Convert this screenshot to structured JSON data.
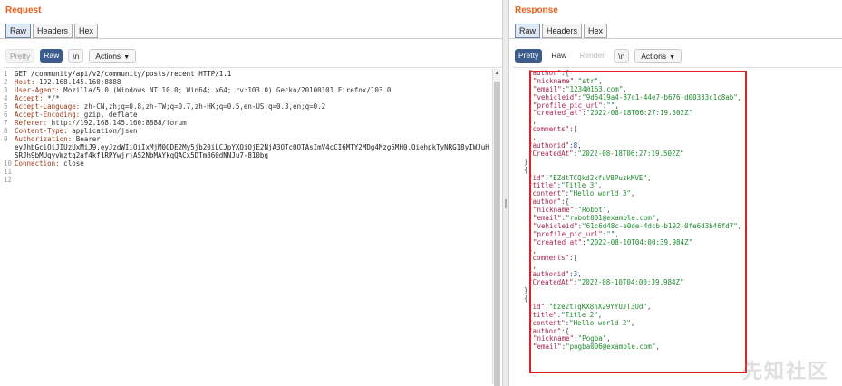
{
  "request": {
    "title": "Request",
    "tabs": [
      {
        "label": "Raw",
        "active": true
      },
      {
        "label": "Headers",
        "active": false
      },
      {
        "label": "Hex",
        "active": false
      }
    ],
    "toolbar": {
      "pretty": "Pretty",
      "raw": "Raw",
      "newline": "\\n",
      "actions": "Actions"
    },
    "line_numbers": [
      "1",
      "2",
      "3",
      "4",
      "5",
      "6",
      "7",
      "8",
      "9",
      "",
      "",
      "10",
      "11",
      "12"
    ],
    "lines": [
      {
        "name": "",
        "value": "GET /community/api/v2/community/posts/recent HTTP/1.1"
      },
      {
        "name": "Host:",
        "value": " 192.168.145.160:8888"
      },
      {
        "name": "User-Agent:",
        "value": " Mozilla/5.0 (Windows NT 10.0; Win64; x64; rv:103.0) Gecko/20100101 Firefox/103.0"
      },
      {
        "name": "Accept:",
        "value": " */*"
      },
      {
        "name": "Accept-Language:",
        "value": " zh-CN,zh;q=0.8,zh-TW;q=0.7,zh-HK;q=0.5,en-US;q=0.3,en;q=0.2"
      },
      {
        "name": "Accept-Encoding:",
        "value": " gzip, deflate"
      },
      {
        "name": "Referer:",
        "value": " http://192.168.145.160:8888/forum"
      },
      {
        "name": "Content-Type:",
        "value": " application/json"
      },
      {
        "name": "Authorization:",
        "value": " Bearer"
      },
      {
        "name": "",
        "value": "eyJhbGciOiJIUzUxMiJ9.eyJzdWIiOiIxMjM0QDE2My5jb20iLCJpYXQiOjE2NjA3OTcOOTAsImV4cCI6MTY2MDg4Mzg5MH0.QiehpkTyNRG18yIWJuH9rDOv"
      },
      {
        "name": "",
        "value": "SRJh9bMUqyvWztq2af4kf1RPYwjrjAS2NbMAYkqQACx5DTm860dNNJu7-810bg"
      },
      {
        "name": "Connection:",
        "value": " close"
      },
      {
        "name": "",
        "value": ""
      },
      {
        "name": "",
        "value": ""
      }
    ]
  },
  "response": {
    "title": "Response",
    "tabs": [
      {
        "label": "Raw",
        "active": true
      },
      {
        "label": "Headers",
        "active": false
      },
      {
        "label": "Hex",
        "active": false
      }
    ],
    "toolbar": {
      "pretty": "Pretty",
      "raw": "Raw",
      "render": "Render",
      "newline": "\\n",
      "actions": "Actions"
    },
    "json_lines": [
      {
        "indent": 1,
        "parts": [
          [
            "k",
            "\"author\""
          ],
          [
            "p",
            ":{"
          ]
        ]
      },
      {
        "indent": 2,
        "parts": [
          [
            "k",
            "\"nickname\""
          ],
          [
            "p",
            ":"
          ],
          [
            "s",
            "\"str\""
          ],
          [
            "p",
            ","
          ]
        ]
      },
      {
        "indent": 2,
        "parts": [
          [
            "k",
            "\"email\""
          ],
          [
            "p",
            ":"
          ],
          [
            "s",
            "\"1234@163.com\""
          ],
          [
            "p",
            ","
          ]
        ]
      },
      {
        "indent": 2,
        "parts": [
          [
            "k",
            "\"vehicleid\""
          ],
          [
            "p",
            ":"
          ],
          [
            "s",
            "\"9d5419a4-87c1-44e7-b676-d00333c1c8ab\""
          ],
          [
            "p",
            ","
          ]
        ]
      },
      {
        "indent": 2,
        "parts": [
          [
            "k",
            "\"profile_pic_url\""
          ],
          [
            "p",
            ":"
          ],
          [
            "s",
            "\"\""
          ],
          [
            "p",
            ","
          ]
        ]
      },
      {
        "indent": 2,
        "parts": [
          [
            "k",
            "\"created_at\""
          ],
          [
            "p",
            ":"
          ],
          [
            "s",
            "\"2022-08-18T06:27:19.502Z\""
          ]
        ]
      },
      {
        "indent": 1,
        "parts": [
          [
            "p",
            "},"
          ]
        ]
      },
      {
        "indent": 1,
        "parts": [
          [
            "k",
            "\"comments\""
          ],
          [
            "p",
            ":["
          ]
        ]
      },
      {
        "indent": 1,
        "parts": [
          [
            "p",
            "],"
          ]
        ]
      },
      {
        "indent": 1,
        "parts": [
          [
            "k",
            "\"authorid\""
          ],
          [
            "p",
            ":"
          ],
          [
            "n",
            "8"
          ],
          [
            "p",
            ","
          ]
        ]
      },
      {
        "indent": 1,
        "parts": [
          [
            "k",
            "\"CreatedAt\""
          ],
          [
            "p",
            ":"
          ],
          [
            "s",
            "\"2022-08-18T06:27:19.502Z\""
          ]
        ]
      },
      {
        "indent": 0,
        "parts": [
          [
            "p",
            "},"
          ]
        ]
      },
      {
        "indent": 0,
        "parts": [
          [
            "p",
            "{"
          ]
        ]
      },
      {
        "indent": 1,
        "parts": [
          [
            "k",
            "\"id\""
          ],
          [
            "p",
            ":"
          ],
          [
            "s",
            "\"EZdtTCQkd2xfuVBPuzkMVE\""
          ],
          [
            "p",
            ","
          ]
        ]
      },
      {
        "indent": 1,
        "parts": [
          [
            "k",
            "\"title\""
          ],
          [
            "p",
            ":"
          ],
          [
            "s",
            "\"Title 3\""
          ],
          [
            "p",
            ","
          ]
        ]
      },
      {
        "indent": 1,
        "parts": [
          [
            "k",
            "\"content\""
          ],
          [
            "p",
            ":"
          ],
          [
            "s",
            "\"Hello world 3\""
          ],
          [
            "p",
            ","
          ]
        ]
      },
      {
        "indent": 1,
        "parts": [
          [
            "k",
            "\"author\""
          ],
          [
            "p",
            ":{"
          ]
        ]
      },
      {
        "indent": 2,
        "parts": [
          [
            "k",
            "\"nickname\""
          ],
          [
            "p",
            ":"
          ],
          [
            "s",
            "\"Robot\""
          ],
          [
            "p",
            ","
          ]
        ]
      },
      {
        "indent": 2,
        "parts": [
          [
            "k",
            "\"email\""
          ],
          [
            "p",
            ":"
          ],
          [
            "s",
            "\"robot001@example.com\""
          ],
          [
            "p",
            ","
          ]
        ]
      },
      {
        "indent": 2,
        "parts": [
          [
            "k",
            "\"vehicleid\""
          ],
          [
            "p",
            ":"
          ],
          [
            "s",
            "\"61c6d48c-e0de-4dcb-b192-0fe6d3b46fd7\""
          ],
          [
            "p",
            ","
          ]
        ]
      },
      {
        "indent": 2,
        "parts": [
          [
            "k",
            "\"profile_pic_url\""
          ],
          [
            "p",
            ":"
          ],
          [
            "s",
            "\"\""
          ],
          [
            "p",
            ","
          ]
        ]
      },
      {
        "indent": 2,
        "parts": [
          [
            "k",
            "\"created_at\""
          ],
          [
            "p",
            ":"
          ],
          [
            "s",
            "\"2022-08-10T04:00:39.984Z\""
          ]
        ]
      },
      {
        "indent": 1,
        "parts": [
          [
            "p",
            "},"
          ]
        ]
      },
      {
        "indent": 1,
        "parts": [
          [
            "k",
            "\"comments\""
          ],
          [
            "p",
            ":["
          ]
        ]
      },
      {
        "indent": 1,
        "parts": [
          [
            "p",
            "],"
          ]
        ]
      },
      {
        "indent": 1,
        "parts": [
          [
            "k",
            "\"authorid\""
          ],
          [
            "p",
            ":"
          ],
          [
            "n",
            "3"
          ],
          [
            "p",
            ","
          ]
        ]
      },
      {
        "indent": 1,
        "parts": [
          [
            "k",
            "\"CreatedAt\""
          ],
          [
            "p",
            ":"
          ],
          [
            "s",
            "\"2022-08-10T04:00:39.984Z\""
          ]
        ]
      },
      {
        "indent": 0,
        "parts": [
          [
            "p",
            "},"
          ]
        ]
      },
      {
        "indent": 0,
        "parts": [
          [
            "p",
            "{"
          ]
        ]
      },
      {
        "indent": 1,
        "parts": [
          [
            "k",
            "\"id\""
          ],
          [
            "p",
            ":"
          ],
          [
            "s",
            "\"bze2tTqKX8hX29YYUJT3Ud\""
          ],
          [
            "p",
            ","
          ]
        ]
      },
      {
        "indent": 1,
        "parts": [
          [
            "k",
            "\"title\""
          ],
          [
            "p",
            ":"
          ],
          [
            "s",
            "\"Title 2\""
          ],
          [
            "p",
            ","
          ]
        ]
      },
      {
        "indent": 1,
        "parts": [
          [
            "k",
            "\"content\""
          ],
          [
            "p",
            ":"
          ],
          [
            "s",
            "\"Hello world 2\""
          ],
          [
            "p",
            ","
          ]
        ]
      },
      {
        "indent": 1,
        "parts": [
          [
            "k",
            "\"author\""
          ],
          [
            "p",
            ":{"
          ]
        ]
      },
      {
        "indent": 2,
        "parts": [
          [
            "k",
            "\"nickname\""
          ],
          [
            "p",
            ":"
          ],
          [
            "s",
            "\"Pogba\""
          ],
          [
            "p",
            ","
          ]
        ]
      },
      {
        "indent": 2,
        "parts": [
          [
            "k",
            "\"email\""
          ],
          [
            "p",
            ":"
          ],
          [
            "s",
            "\"pogba006@example.com\""
          ],
          [
            "p",
            ","
          ]
        ]
      }
    ],
    "watermark": "先知社区"
  },
  "colors": {
    "title": "#e8601c",
    "highlight": "#e02020",
    "json_key": "#a6244c",
    "json_string": "#1e8a2e",
    "json_number": "#1e3f9a",
    "header_name": "#9a3a1a"
  }
}
